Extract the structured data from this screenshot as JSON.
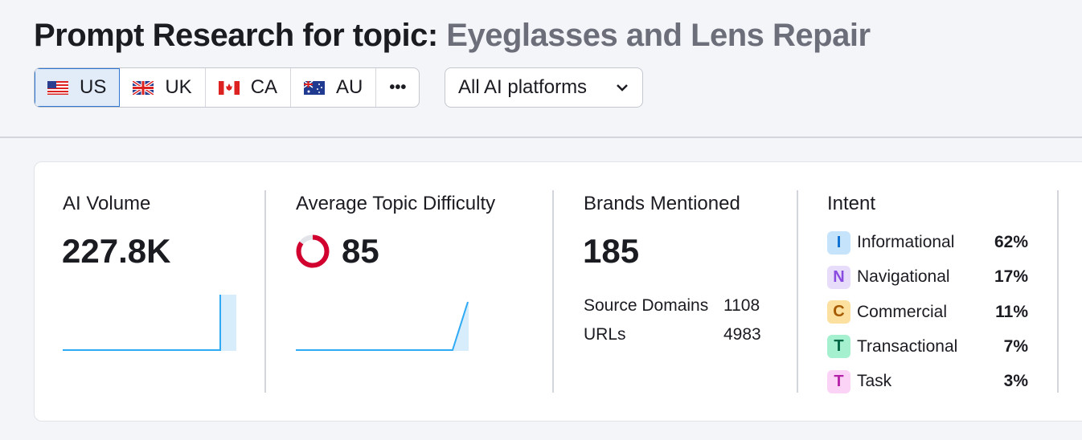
{
  "header": {
    "title_prefix": "Prompt Research for topic:",
    "topic": "Eyeglasses and Lens Repair"
  },
  "countries": [
    {
      "code": "US",
      "icon": "us-flag-icon",
      "active": true
    },
    {
      "code": "UK",
      "icon": "uk-flag-icon"
    },
    {
      "code": "CA",
      "icon": "ca-flag-icon"
    },
    {
      "code": "AU",
      "icon": "au-flag-icon"
    }
  ],
  "more_label": "•••",
  "platform_dropdown": {
    "value": "All AI platforms",
    "icon": "chevron-down-icon"
  },
  "ai_volume": {
    "label": "AI Volume",
    "value": "227.8K"
  },
  "difficulty": {
    "label": "Average Topic Difficulty",
    "value": "85",
    "percent": 85,
    "color": "#d1002f"
  },
  "brands": {
    "label": "Brands Mentioned",
    "value": "185",
    "source_domains_label": "Source Domains",
    "source_domains": "1108",
    "urls_label": "URLs",
    "urls": "4983"
  },
  "intent": {
    "label": "Intent",
    "items": [
      {
        "letter": "I",
        "name": "Informational",
        "pct": "62%",
        "bg": "#c5e4fb",
        "fg": "#0b6fd1"
      },
      {
        "letter": "N",
        "name": "Navigational",
        "pct": "17%",
        "bg": "#e8dcfb",
        "fg": "#8a4be0"
      },
      {
        "letter": "C",
        "name": "Commercial",
        "pct": "11%",
        "bg": "#fbe0a0",
        "fg": "#a65a00"
      },
      {
        "letter": "T",
        "name": "Transactional",
        "pct": "7%",
        "bg": "#a5f0cf",
        "fg": "#006644"
      },
      {
        "letter": "T",
        "name": "Task",
        "pct": "3%",
        "bg": "#fbd3f7",
        "fg": "#b524a8"
      }
    ]
  }
}
